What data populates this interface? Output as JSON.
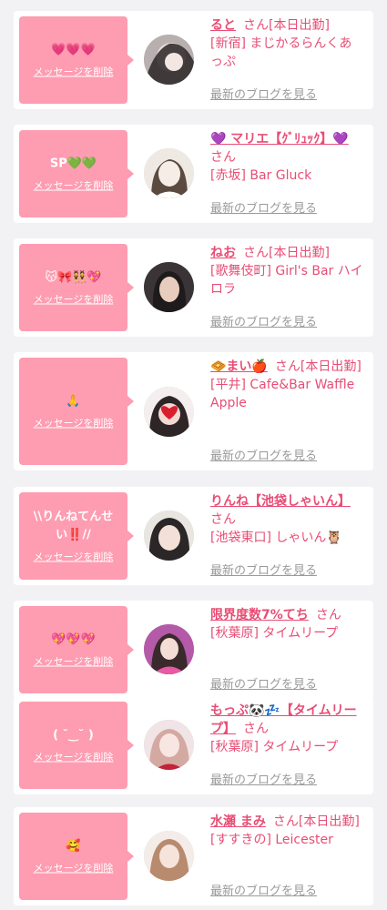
{
  "common": {
    "delete_label": "メッセージを削除",
    "blog_label": "最新のブログを見る"
  },
  "items": [
    {
      "message": "💗💗💗",
      "name": "ると",
      "suffix": "さん[本日出勤]",
      "shop": "[新宿] まじかるらんくあっぷ",
      "avatar_icon": "avatar-photo-icon"
    },
    {
      "message": "SP💚💚",
      "name": "💜 マリエ【ｸﾞﾘｭｯｸ】💜",
      "suffix": "さん",
      "shop": "[赤坂] Bar Gluck",
      "avatar_icon": "avatar-photo-icon"
    },
    {
      "message": "😽🎀👯💖",
      "name": "ねお",
      "suffix": "さん[本日出勤]",
      "shop": "[歌舞伎町] Girl's Bar ハイロラ",
      "avatar_icon": "avatar-photo-icon"
    },
    {
      "message": "🙏",
      "name": "🧇まい🍎",
      "suffix": "さん[本日出勤]",
      "shop": "[平井] Cafe&Bar Waffle Apple",
      "avatar_icon": "avatar-photo-icon"
    },
    {
      "message": "\\\\りんねてんせい‼️//",
      "name": "りんね【池袋しゃいん】",
      "suffix": "さん",
      "shop": "[池袋東口] しゃいん🦉",
      "avatar_icon": "avatar-photo-icon"
    },
    {
      "message": "💖💖💖",
      "name": "限界度数7%てち",
      "suffix": "さん",
      "shop": "[秋葉原] タイムリープ",
      "avatar_icon": "avatar-photo-icon"
    },
    {
      "message": "( ˘‿˘ )",
      "name": "もっぷ🐼💤【タイムリープ】",
      "suffix": "さん",
      "shop": "[秋葉原] タイムリープ",
      "avatar_icon": "avatar-photo-icon"
    },
    {
      "message": "🥰",
      "name": "水瀬 まみ",
      "suffix": "さん[本日出勤]",
      "shop": "[すすきの] Leicester",
      "avatar_icon": "avatar-photo-icon"
    }
  ],
  "colors": {
    "bubble": "#fe9cb1",
    "accent": "#e84d75",
    "muted": "#9a9a9a",
    "background": "#f2f2f4"
  }
}
